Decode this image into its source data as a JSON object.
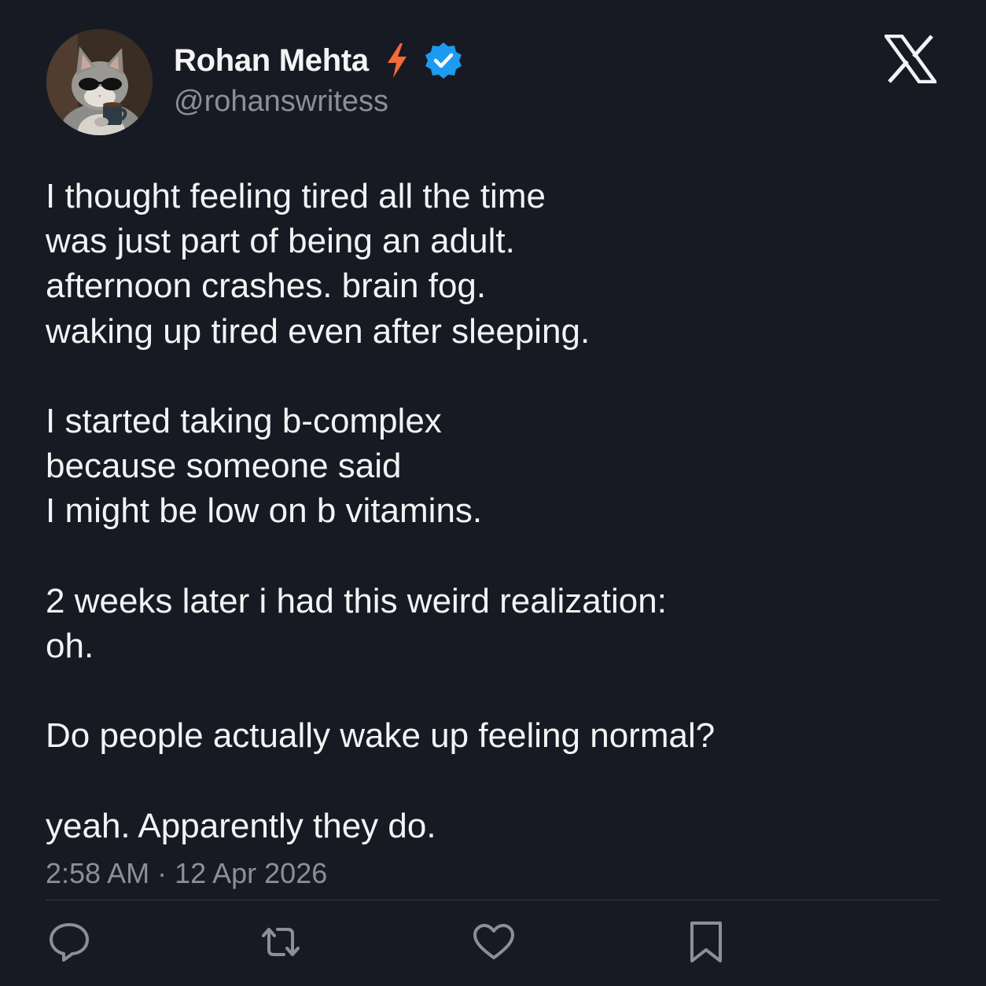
{
  "author": {
    "name": "Rohan Mehta",
    "handle": "@rohanswritess",
    "verified": true,
    "avatar_icon": "cat-with-sunglasses-avatar"
  },
  "brand": {
    "logo_icon": "x-logo-icon"
  },
  "tweet": {
    "lines": [
      "I thought feeling tired all the time",
      "was just part of being an adult.",
      "afternoon crashes. brain fog.",
      "waking up tired even after sleeping.",
      "",
      "I started taking b-complex",
      "because someone said",
      "I might be low on b vitamins.",
      "",
      "2 weeks later i had this weird realization:",
      "oh.",
      "",
      "Do people actually wake up feeling normal?",
      "",
      "yeah. Apparently they do."
    ],
    "timestamp": "2:58 AM · 12 Apr 2026"
  },
  "actions": {
    "reply_icon": "reply-icon",
    "retweet_icon": "retweet-icon",
    "like_icon": "heart-icon",
    "bookmark_icon": "bookmark-icon"
  },
  "colors": {
    "background": "#181a23",
    "text": "#f3f3f5",
    "muted": "#8b8f9a",
    "verified_blue": "#1d9bf0",
    "bolt_orange": "#f26b3a"
  }
}
